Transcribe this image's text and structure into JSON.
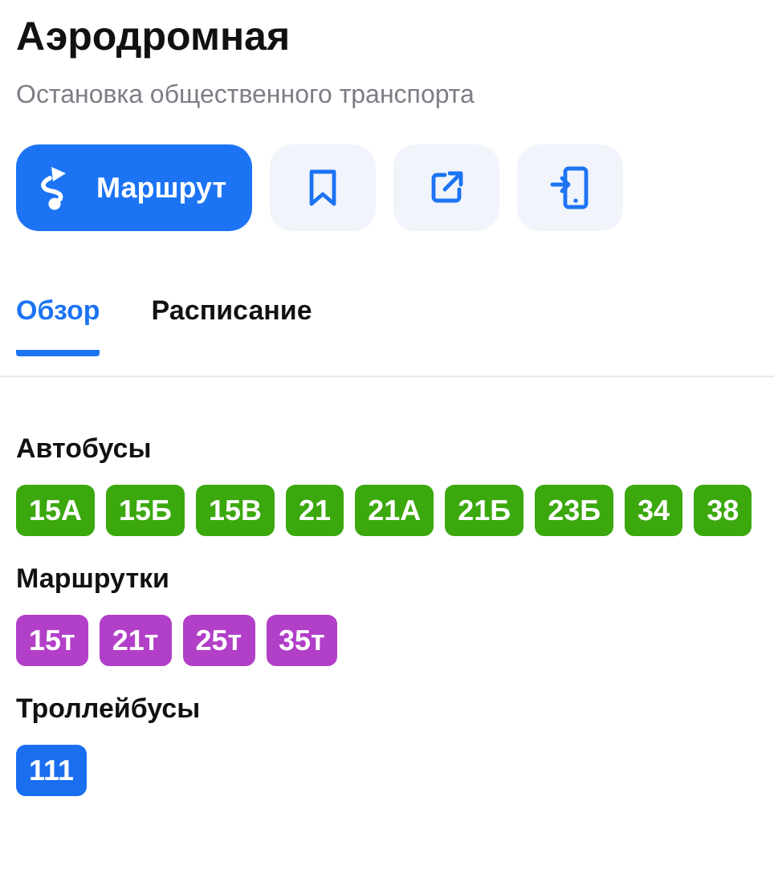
{
  "title": "Аэродромная",
  "subtitle": "Остановка общественного транспорта",
  "actions": [
    {
      "kind": "route",
      "label": "Маршрут"
    },
    {
      "kind": "bookmark"
    },
    {
      "kind": "share"
    },
    {
      "kind": "send-to-phone"
    }
  ],
  "tabs": [
    {
      "label": "Обзор",
      "selected": true
    },
    {
      "label": "Расписание",
      "selected": false
    }
  ],
  "groups": [
    {
      "title": "Автобусы",
      "color": "#3ba80e",
      "routes": [
        "15А",
        "15Б",
        "15В",
        "21",
        "21А",
        "21Б",
        "23Б",
        "34",
        "38"
      ]
    },
    {
      "title": "Маршрутки",
      "color": "#b23fc8",
      "routes": [
        "15т",
        "21т",
        "25т",
        "35т"
      ]
    },
    {
      "title": "Троллейбусы",
      "color": "#1a6ff0",
      "routes": [
        "111"
      ]
    }
  ]
}
